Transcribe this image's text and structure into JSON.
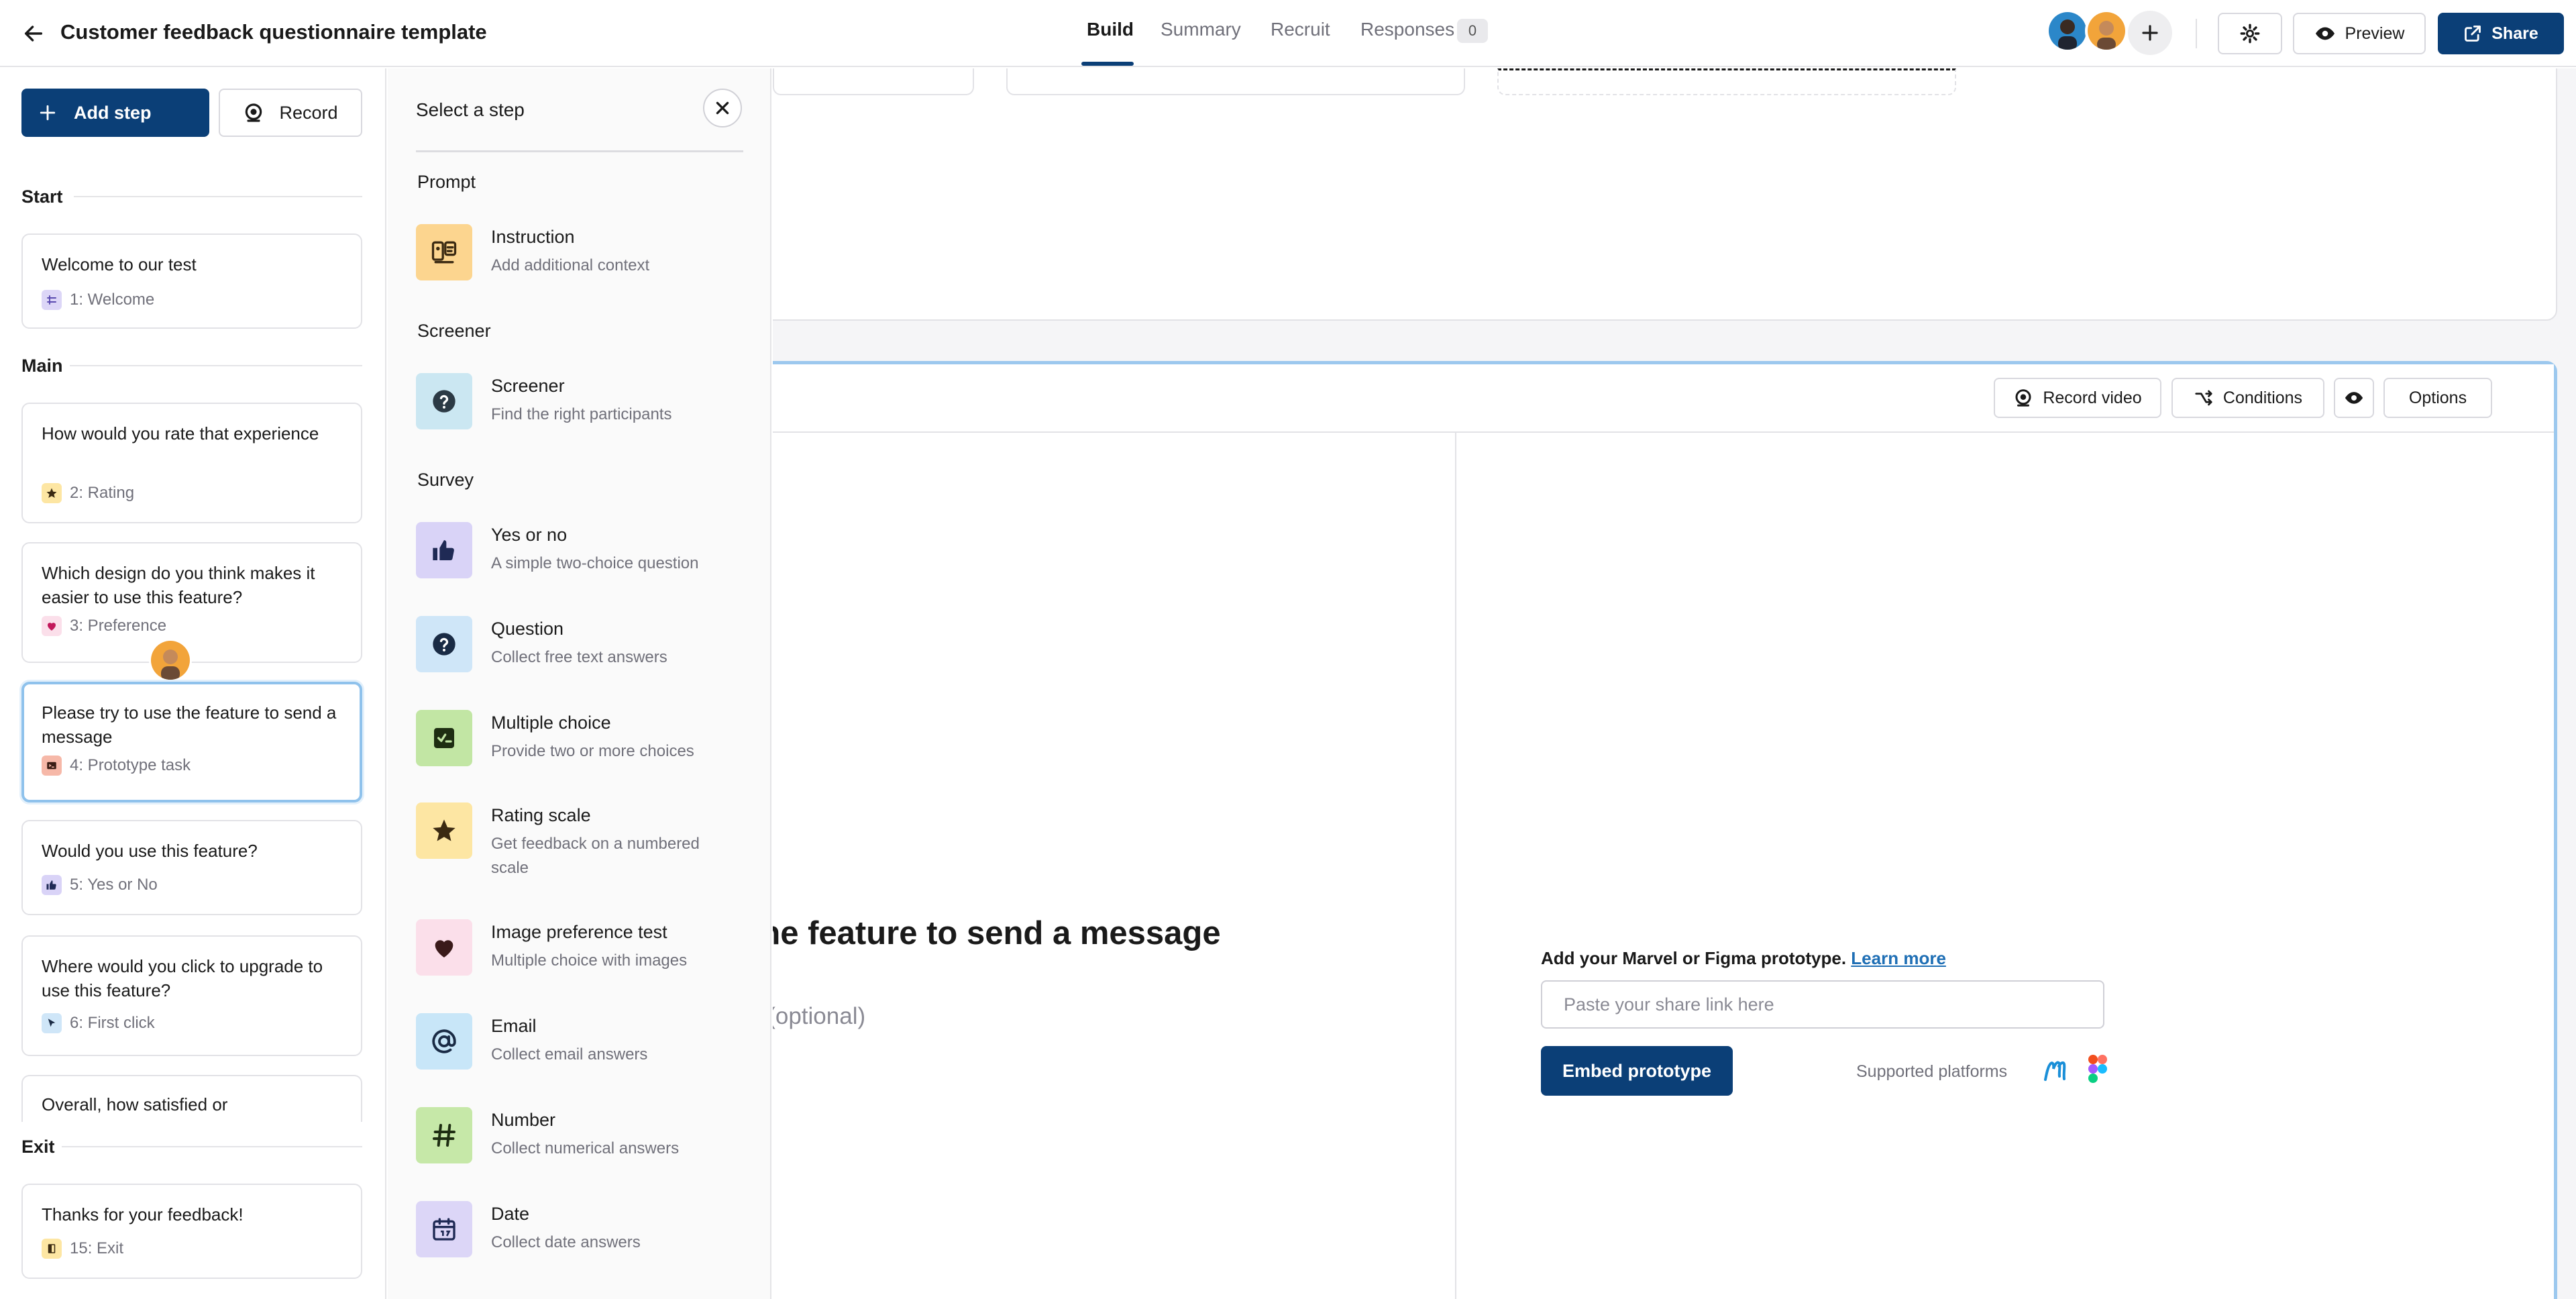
{
  "header": {
    "title": "Customer feedback questionnaire template",
    "tabs": [
      {
        "label": "Build"
      },
      {
        "label": "Summary"
      },
      {
        "label": "Recruit"
      },
      {
        "label": "Responses"
      }
    ],
    "responses_count": "0",
    "preview_label": "Preview",
    "share_label": "Share"
  },
  "sidebar": {
    "add_step_label": "Add step",
    "record_label": "Record",
    "sections": {
      "start": "Start",
      "main": "Main",
      "exit": "Exit"
    },
    "steps": [
      {
        "title": "Welcome to our test",
        "meta": "1: Welcome"
      },
      {
        "title": "How would you rate that experience",
        "meta": "2: Rating"
      },
      {
        "title": "Which design do you think makes it easier to use this feature?",
        "meta": "3: Preference"
      },
      {
        "title": "Please try to use the feature to send a message",
        "meta": "4: Prototype task"
      },
      {
        "title": "Would you use this feature?",
        "meta": "5: Yes or No"
      },
      {
        "title": "Where would you click to upgrade to use this feature?",
        "meta": "6: First click"
      },
      {
        "title": "Overall, how satisfied or",
        "meta": ""
      },
      {
        "title": "Thanks for your feedback!",
        "meta": "15: Exit"
      }
    ]
  },
  "picker": {
    "title": "Select a step",
    "categories": {
      "prompt": "Prompt",
      "screener": "Screener",
      "survey": "Survey"
    },
    "options": [
      {
        "name": "Instruction",
        "desc": "Add additional context",
        "color": "#fcd58f"
      },
      {
        "name": "Screener",
        "desc": "Find the right participants",
        "color": "#cbe7f2"
      },
      {
        "name": "Yes or no",
        "desc": "A simple two-choice question",
        "color": "#d9d3f7"
      },
      {
        "name": "Question",
        "desc": "Collect free text answers",
        "color": "#cfe6f8"
      },
      {
        "name": "Multiple choice",
        "desc": "Provide two or more choices",
        "color": "#c2e6a4"
      },
      {
        "name": "Rating scale",
        "desc": "Get feedback on a numbered scale",
        "color": "#fde6a3"
      },
      {
        "name": "Image preference test",
        "desc": "Multiple choice with images",
        "color": "#fbdfea"
      },
      {
        "name": "Email",
        "desc": "Collect email answers",
        "color": "#c8e6f8"
      },
      {
        "name": "Number",
        "desc": "Collect numerical answers",
        "color": "#c6e8a8"
      },
      {
        "name": "Date",
        "desc": "Collect date answers",
        "color": "#dcd6f7"
      }
    ]
  },
  "editor": {
    "toolbar": {
      "record_video": "Record video",
      "conditions": "Conditions",
      "options": "Options"
    },
    "task_title_visible": "the feature to send a message",
    "task_hint_visible": "s (optional)",
    "prototype": {
      "label": "Add your Marvel or Figma prototype.",
      "learn_more": "Learn more",
      "placeholder": "Paste your share link here",
      "embed_label": "Embed prototype",
      "supported_label": "Supported platforms"
    }
  },
  "colors": {
    "brand": "#0b3f77",
    "selected_border": "#9cc8ee",
    "link": "#1f6fb5"
  }
}
